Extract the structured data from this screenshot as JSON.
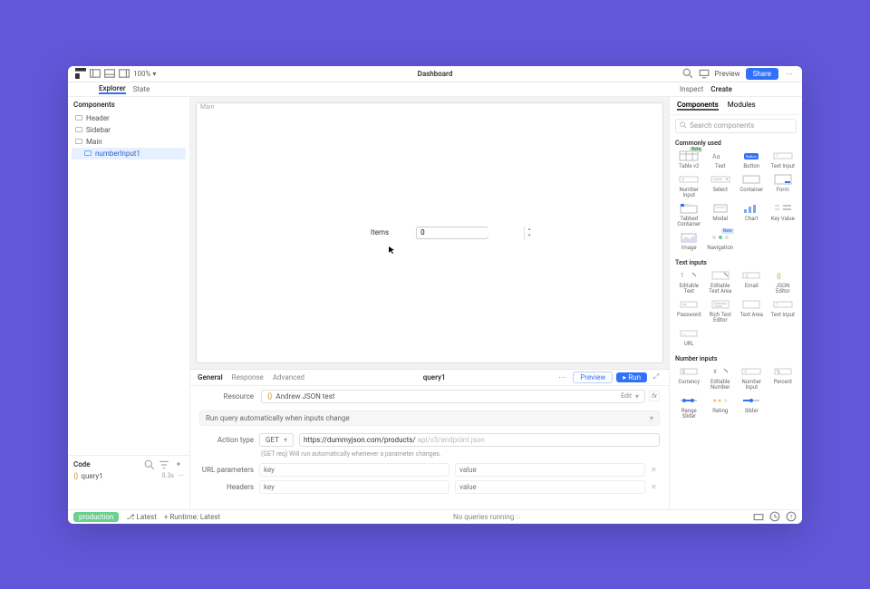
{
  "topbar": {
    "zoom": "100%",
    "title": "Dashboard",
    "preview": "Preview",
    "share": "Share"
  },
  "subbar": {
    "left": {
      "explorer": "Explorer",
      "state": "State"
    },
    "right": {
      "inspect": "Inspect",
      "create": "Create"
    }
  },
  "leftPanel": {
    "componentsHead": "Components",
    "tree": [
      {
        "label": "Header"
      },
      {
        "label": "Sidebar"
      },
      {
        "label": "Main"
      }
    ],
    "mainChild": "numberInput1",
    "codeHead": "Code",
    "codeItem": {
      "name": "query1",
      "time": "0.3s"
    }
  },
  "canvas": {
    "crumb": "Main",
    "itemsLabel": "Items",
    "itemsValue": "0"
  },
  "query": {
    "tabs": {
      "general": "General",
      "response": "Response",
      "advanced": "Advanced"
    },
    "name": "query1",
    "preview": "Preview",
    "run": "Run",
    "resourceLabel": "Resource",
    "resourceValue": "Andrew JSON test",
    "edit": "Edit",
    "autoRun": "Run query automatically when inputs change",
    "actionTypeLabel": "Action type",
    "actionType": "GET",
    "urlPrefix": "https://dummyjson.com/products/",
    "urlPlaceholder": "api/v3/endpoint.json",
    "hint": "(GET req) Will run automatically whenever a parameter changes.",
    "urlParamsLabel": "URL parameters",
    "headersLabel": "Headers",
    "keyPlaceholder": "key",
    "valuePlaceholder": "value"
  },
  "rightPanel": {
    "tabs": {
      "components": "Components",
      "modules": "Modules"
    },
    "searchPlaceholder": "Search components",
    "sections": {
      "common": "Commonly used",
      "textInputs": "Text inputs",
      "numberInputs": "Number inputs"
    },
    "common": [
      "Table v2",
      "Text",
      "Button",
      "Text Input",
      "Number Input",
      "Select",
      "Container",
      "Form",
      "Tabbed Container",
      "Modal",
      "Chart",
      "Key Value",
      "Image",
      "Navigation"
    ],
    "textInputs": [
      "Editable Text",
      "Editable Text Area",
      "Email",
      "JSON Editor",
      "Password",
      "Rich Text Editor",
      "Text Area",
      "Text Input",
      "URL"
    ],
    "numberInputs": [
      "Currency",
      "Editable Number",
      "Number Input",
      "Percent",
      "Range Slider",
      "Rating",
      "Slider"
    ],
    "badgeBeta": "Beta",
    "badgeNew": "New"
  },
  "bottombar": {
    "production": "production",
    "latest": "Latest",
    "runtime": "Runtime: Latest",
    "status": "No queries running"
  }
}
